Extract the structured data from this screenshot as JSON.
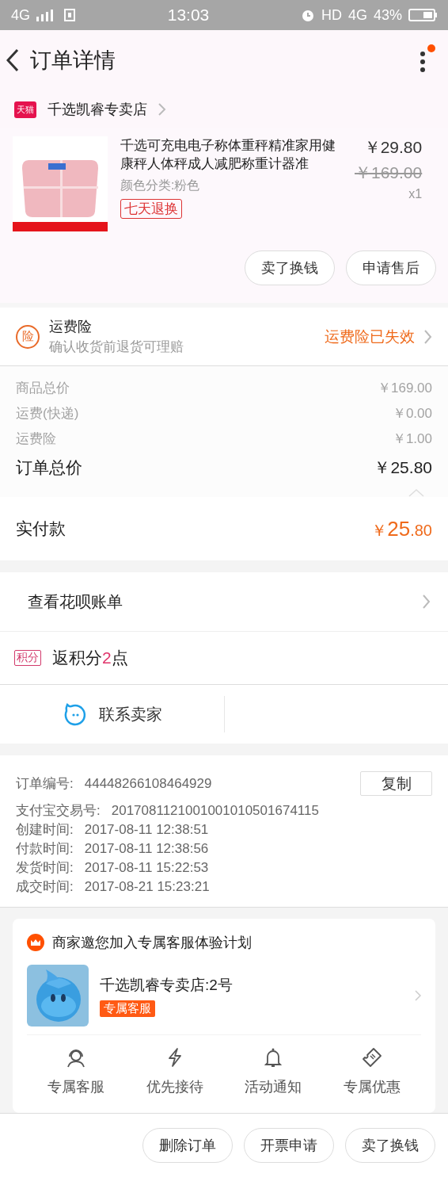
{
  "status_bar": {
    "network": "4G",
    "time": "13:03",
    "hd": "HD",
    "network_right": "4G",
    "battery": "43%"
  },
  "header": {
    "title": "订单详情",
    "has_notification": true
  },
  "store": {
    "name": "千选凯睿专卖店",
    "badge": "天猫"
  },
  "product": {
    "title": "千选可充电电子称体重秤精准家用健康秤人体秤成人减肥称重计器准",
    "variant": "颜色分类:粉色",
    "tag": "七天退换",
    "price": "￥29.80",
    "original_price": "￥169.00",
    "quantity": "x1"
  },
  "product_actions": [
    "卖了换钱",
    "申请售后"
  ],
  "insurance": {
    "icon": "险",
    "title": "运费险",
    "subtitle": "确认收货前退货可理赔",
    "status": "运费险已失效"
  },
  "price_rows": [
    {
      "label": "商品总价",
      "value": "￥169.00",
      "kind": "minor"
    },
    {
      "label": "运费(快递)",
      "value": "￥0.00",
      "kind": "minor"
    },
    {
      "label": "运费险",
      "value": "￥1.00",
      "kind": "minor"
    },
    {
      "label": "订单总价",
      "value": "￥25.80",
      "kind": "total"
    }
  ],
  "paid": {
    "label": "实付款",
    "currency": "￥",
    "integer": "25",
    "decimal": ".80"
  },
  "huabei": {
    "label": "查看花呗账单"
  },
  "points": {
    "badge": "积分",
    "prefix": "返积分",
    "number": "2",
    "suffix": "点"
  },
  "contact": {
    "label": "联系卖家"
  },
  "order_info": {
    "copy_button": "复制",
    "rows": [
      {
        "label": "订单编号:",
        "value": "44448266108464929"
      },
      {
        "label": "支付宝交易号:",
        "value": "2017081121001001010501674115"
      },
      {
        "label": "创建时间:",
        "value": "2017-08-11 12:38:51"
      },
      {
        "label": "付款时间:",
        "value": "2017-08-11 12:38:56"
      },
      {
        "label": "发货时间:",
        "value": "2017-08-11 15:22:53"
      },
      {
        "label": "成交时间:",
        "value": "2017-08-21 15:23:21"
      }
    ]
  },
  "service_card": {
    "title": "商家邀您加入专属客服体验计划",
    "agent": "千选凯睿专卖店:2号",
    "agent_tag": "专属客服",
    "features": [
      {
        "label": "专属客服",
        "kind": "headset"
      },
      {
        "label": "优先接待",
        "kind": "bolt"
      },
      {
        "label": "活动通知",
        "kind": "bell"
      },
      {
        "label": "专属优惠",
        "kind": "ticket"
      }
    ]
  },
  "bottom_actions": [
    "删除订单",
    "开票申请",
    "卖了换钱"
  ]
}
